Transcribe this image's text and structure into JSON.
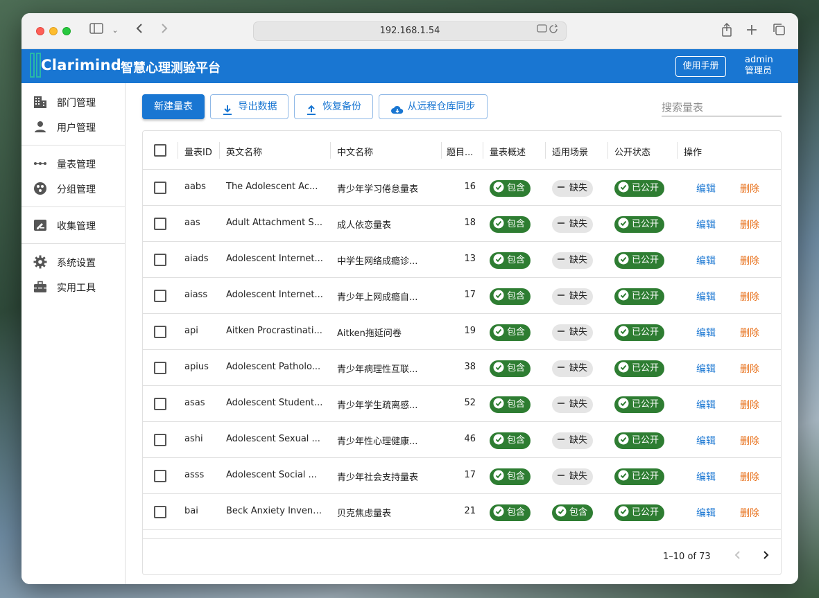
{
  "browser": {
    "address": "192.168.1.54"
  },
  "app": {
    "logo_text": "Clarimind",
    "title": "智慧心理测验平台",
    "manual_button": "使用手册",
    "user_name": "admin",
    "user_role": "管理员"
  },
  "sidebar": {
    "items": [
      {
        "label": "部门管理",
        "icon": "building-icon"
      },
      {
        "label": "用户管理",
        "icon": "person-icon"
      },
      {
        "label": "量表管理",
        "icon": "scale-line-icon"
      },
      {
        "label": "分组管理",
        "icon": "group-circle-icon"
      },
      {
        "label": "收集管理",
        "icon": "edit-board-icon"
      },
      {
        "label": "系统设置",
        "icon": "gear-icon"
      },
      {
        "label": "实用工具",
        "icon": "toolbox-icon"
      }
    ]
  },
  "toolbar": {
    "new_button": "新建量表",
    "export_button": "导出数据",
    "restore_button": "恢复备份",
    "sync_button": "从远程仓库同步",
    "search_placeholder": "搜索量表"
  },
  "table": {
    "headers": [
      "量表ID",
      "英文名称",
      "中文名称",
      "题目...",
      "量表概述",
      "适用场景",
      "公开状态",
      "操作"
    ],
    "rows": [
      {
        "id": "aabs",
        "en": "The Adolescent Ac...",
        "zh": "青少年学习倦怠量表",
        "count": "16",
        "overview": "包含",
        "scene": "缺失",
        "status": "已公开"
      },
      {
        "id": "aas",
        "en": "Adult Attachment S...",
        "zh": "成人依恋量表",
        "count": "18",
        "overview": "包含",
        "scene": "缺失",
        "status": "已公开"
      },
      {
        "id": "aiads",
        "en": "Adolescent Internet...",
        "zh": "中学生网络成瘾诊...",
        "count": "13",
        "overview": "包含",
        "scene": "缺失",
        "status": "已公开"
      },
      {
        "id": "aiass",
        "en": "Adolescent Internet...",
        "zh": "青少年上网成瘾自...",
        "count": "17",
        "overview": "包含",
        "scene": "缺失",
        "status": "已公开"
      },
      {
        "id": "api",
        "en": "Aitken Procrastinati...",
        "zh": "Aitken拖延问卷",
        "count": "19",
        "overview": "包含",
        "scene": "缺失",
        "status": "已公开"
      },
      {
        "id": "apius",
        "en": "Adolescent Patholo...",
        "zh": "青少年病理性互联...",
        "count": "38",
        "overview": "包含",
        "scene": "缺失",
        "status": "已公开"
      },
      {
        "id": "asas",
        "en": "Adolescent Student...",
        "zh": "青少年学生疏离感...",
        "count": "52",
        "overview": "包含",
        "scene": "缺失",
        "status": "已公开"
      },
      {
        "id": "ashi",
        "en": "Adolescent Sexual ...",
        "zh": "青少年性心理健康...",
        "count": "46",
        "overview": "包含",
        "scene": "缺失",
        "status": "已公开"
      },
      {
        "id": "asss",
        "en": "Adolescent Social ...",
        "zh": "青少年社会支持量表",
        "count": "17",
        "overview": "包含",
        "scene": "缺失",
        "status": "已公开"
      },
      {
        "id": "bai",
        "en": "Beck Anxiety Invent...",
        "zh": "贝克焦虑量表",
        "count": "21",
        "overview": "包含",
        "scene": "包含",
        "status": "已公开"
      }
    ],
    "edit_label": "编辑",
    "delete_label": "删除",
    "pagination": "1–10 of 73"
  },
  "colors": {
    "primary": "#1976d2",
    "chip_green": "#2e7d32",
    "chip_grey": "#e5e5e5",
    "delete": "#e8711c"
  }
}
